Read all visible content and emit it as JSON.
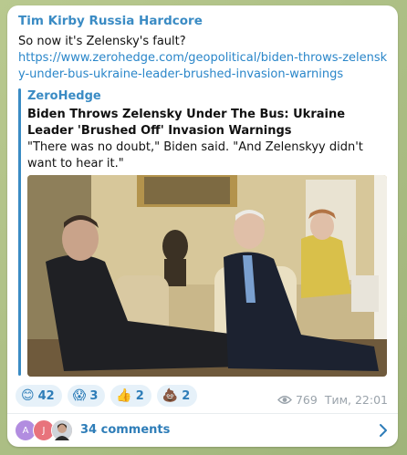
{
  "post": {
    "author": "Tim Kirby Russia Hardcore",
    "text": "So now it's Zelensky's fault?",
    "link": "https://www.zerohedge.com/geopolitical/biden-throws-zelensky-under-bus-ukraine-leader-brushed-invasion-warnings"
  },
  "preview": {
    "site": "ZeroHedge",
    "title": "Biden Throws Zelensky Under The Bus: Ukraine Leader 'Brushed Off' Invasion Warnings",
    "description": "\"There was no doubt,\" Biden said. \"And Zelenskyy didn't want to hear it.\""
  },
  "reactions": [
    {
      "emoji": "😊",
      "count": "42"
    },
    {
      "emoji": "😱",
      "count": "3"
    },
    {
      "emoji": "👍",
      "count": "2"
    },
    {
      "emoji": "💩",
      "count": "2"
    }
  ],
  "meta": {
    "views": "769",
    "time": "Тим, 22:01"
  },
  "comments": {
    "label": "34 comments",
    "avatars": [
      {
        "initial": "A",
        "color": "#b28de0"
      },
      {
        "initial": "J",
        "color": "#e8737c"
      },
      {
        "initial": "",
        "color": "#c9a18a"
      }
    ]
  },
  "colors": {
    "accent": "#3a8bc4",
    "background": "#a9bd86",
    "reaction_bg": "#e6f1f9"
  },
  "icons": [
    "eye-icon",
    "chevron-right-icon"
  ]
}
